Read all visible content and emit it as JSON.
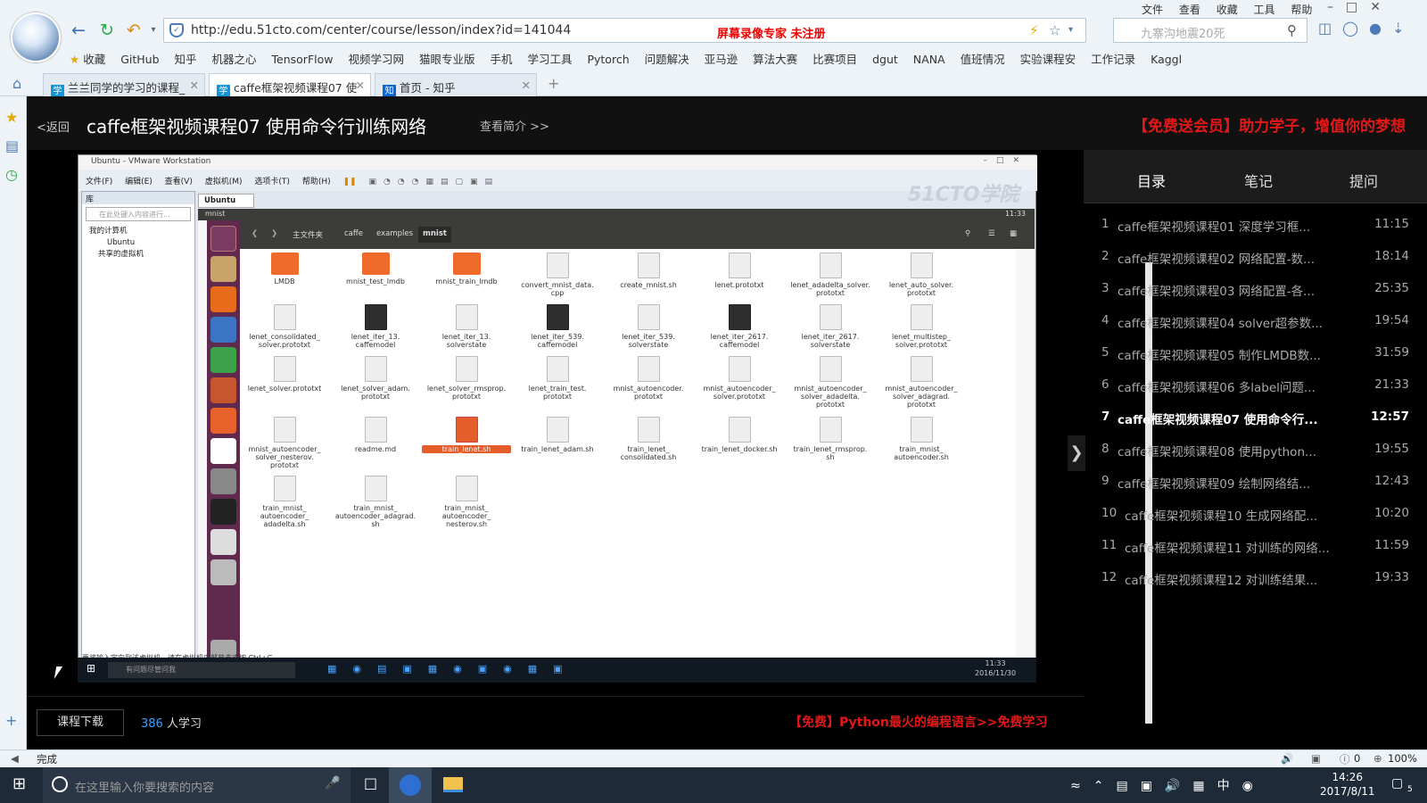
{
  "browser": {
    "url": "http://edu.51cto.com/center/course/lesson/index?id=141044",
    "recorder_text": "屏幕录像专家  未注册",
    "search_placeholder": "九寨沟地震20死",
    "top_menu": [
      "文件",
      "查看",
      "收藏",
      "工具",
      "帮助"
    ],
    "bookmarks": [
      "收藏",
      "GitHub",
      "知乎",
      "机器之心",
      "TensorFlow",
      "视频学习网",
      "猫眼专业版",
      "手机",
      "学习工具",
      "Pytorch",
      "问题解决",
      "亚马逊",
      "算法大赛",
      "比赛项目",
      "dgut",
      "NANA",
      "值班情况",
      "实验课程安",
      "工作记录",
      "Kaggl"
    ],
    "tabs": [
      {
        "label": "兰兰同学的学习的课程_",
        "active": false
      },
      {
        "label": "caffe框架视频课程07 使",
        "active": true
      },
      {
        "label": "首页 - 知乎",
        "active": false
      }
    ],
    "status_left": "完成",
    "zoom": "100%",
    "status_count": "0"
  },
  "course": {
    "back": "<返回",
    "title": "caffe框架视频课程07 使用命令行训练网络",
    "intro_link": "查看简介 >>",
    "promo": "【免费送会员】助力学子，增值你的梦想",
    "download_label": "课程下载",
    "learners_count": "386",
    "learners_suffix": "人学习",
    "promo_bottom": "【免费】Python最火的编程语言>>免费学习"
  },
  "sidebar": {
    "tabs": [
      "目录",
      "笔记",
      "提问"
    ],
    "lessons": [
      {
        "n": "1",
        "title": "caffe框架视频课程01 深度学习框...",
        "dur": "11:15"
      },
      {
        "n": "2",
        "title": "caffe框架视频课程02 网络配置-数...",
        "dur": "18:14"
      },
      {
        "n": "3",
        "title": "caffe框架视频课程03 网络配置-各...",
        "dur": "25:35"
      },
      {
        "n": "4",
        "title": "caffe框架视频课程04 solver超参数...",
        "dur": "19:54"
      },
      {
        "n": "5",
        "title": "caffe框架视频课程05 制作LMDB数...",
        "dur": "31:59"
      },
      {
        "n": "6",
        "title": "caffe框架视频课程06 多label问题...",
        "dur": "21:33"
      },
      {
        "n": "7",
        "title": "caffe框架视频课程07 使用命令行...",
        "dur": "12:57",
        "current": true
      },
      {
        "n": "8",
        "title": "caffe框架视频课程08 使用python...",
        "dur": "19:55"
      },
      {
        "n": "9",
        "title": "caffe框架视频课程09 绘制网络结...",
        "dur": "12:43"
      },
      {
        "n": "10",
        "title": "caffe框架视频课程10 生成网络配...",
        "dur": "10:20"
      },
      {
        "n": "11",
        "title": "caffe框架视频课程11 对训练的网络...",
        "dur": "11:59"
      },
      {
        "n": "12",
        "title": "caffe框架视频课程12 对训练结果...",
        "dur": "19:33"
      }
    ]
  },
  "video": {
    "vm_title": "Ubuntu - VMware Workstation",
    "vm_menu": [
      "文件(F)",
      "编辑(E)",
      "查看(V)",
      "虚拟机(M)",
      "选项卡(T)",
      "帮助(H)"
    ],
    "watermark": "51CTO学院",
    "library_title": "库",
    "library_search": "在此处键入内容进行...",
    "tree": [
      "我的计算机",
      "Ubuntu",
      "共享的虚拟机"
    ],
    "vm_tab": "Ubuntu",
    "window_name": "mnist",
    "ubuntu_time": "11:33",
    "crumbs": [
      "主文件夹",
      "caffe",
      "examples",
      "mnist"
    ],
    "files": [
      {
        "name": "LMDB",
        "kind": "folder"
      },
      {
        "name": "mnist_test_lmdb",
        "kind": "folder"
      },
      {
        "name": "mnist_train_lmdb",
        "kind": "folder"
      },
      {
        "name": "convert_mnist_data.\ncpp",
        "kind": "doc"
      },
      {
        "name": "create_mnist.sh",
        "kind": "doc"
      },
      {
        "name": "lenet.prototxt",
        "kind": "doc"
      },
      {
        "name": "lenet_adadelta_solver.\nprototxt",
        "kind": "doc"
      },
      {
        "name": "lenet_auto_solver.\nprototxt",
        "kind": "doc"
      },
      {
        "name": "lenet_consolidated_\nsolver.prototxt",
        "kind": "doc"
      },
      {
        "name": "lenet_iter_13.\ncaffemodel",
        "kind": "black"
      },
      {
        "name": "lenet_iter_13.\nsolverstate",
        "kind": "doc"
      },
      {
        "name": "lenet_iter_539.\ncaffemodel",
        "kind": "black"
      },
      {
        "name": "lenet_iter_539.\nsolverstate",
        "kind": "doc"
      },
      {
        "name": "lenet_iter_2617.\ncaffemodel",
        "kind": "black"
      },
      {
        "name": "lenet_iter_2617.\nsolverstate",
        "kind": "doc"
      },
      {
        "name": "lenet_multistep_\nsolver.prototxt",
        "kind": "doc"
      },
      {
        "name": "lenet_solver.prototxt",
        "kind": "doc"
      },
      {
        "name": "lenet_solver_adam.\nprototxt",
        "kind": "doc"
      },
      {
        "name": "lenet_solver_rmsprop.\nprototxt",
        "kind": "doc"
      },
      {
        "name": "lenet_train_test.\nprototxt",
        "kind": "doc"
      },
      {
        "name": "mnist_autoencoder.\nprototxt",
        "kind": "doc"
      },
      {
        "name": "mnist_autoencoder_\nsolver.prototxt",
        "kind": "doc"
      },
      {
        "name": "mnist_autoencoder_\nsolver_adadelta.\nprototxt",
        "kind": "doc"
      },
      {
        "name": "mnist_autoencoder_\nsolver_adagrad.\nprototxt",
        "kind": "doc"
      },
      {
        "name": "mnist_autoencoder_\nsolver_nesterov.\nprototxt",
        "kind": "doc"
      },
      {
        "name": "readme.md",
        "kind": "doc"
      },
      {
        "name": "train_lenet.sh",
        "kind": "sh",
        "selected": true
      },
      {
        "name": "train_lenet_adam.sh",
        "kind": "doc"
      },
      {
        "name": "train_lenet_\nconsolidated.sh",
        "kind": "doc"
      },
      {
        "name": "train_lenet_docker.sh",
        "kind": "doc"
      },
      {
        "name": "train_lenet_rmsprop.\nsh",
        "kind": "doc"
      },
      {
        "name": "train_mnist_\nautoencoder.sh",
        "kind": "doc"
      },
      {
        "name": "train_mnist_\nautoencoder_\nadadelta.sh",
        "kind": "doc"
      },
      {
        "name": "train_mnist_\nautoencoder_adagrad.\nsh",
        "kind": "doc"
      },
      {
        "name": "train_mnist_\nautoencoder_\nnesterov.sh",
        "kind": "doc"
      }
    ],
    "vm_status": "要将输入定向到该虚拟机，请在虚拟机内部单击或按 Ctrl+G。",
    "inner_search": "有问题尽管问我",
    "inner_time": "11:33",
    "inner_date": "2016/11/30"
  },
  "taskbar": {
    "search_placeholder": "在这里输入你要搜索的内容",
    "time": "14:26",
    "date": "2017/8/11",
    "notif_count": "5"
  }
}
